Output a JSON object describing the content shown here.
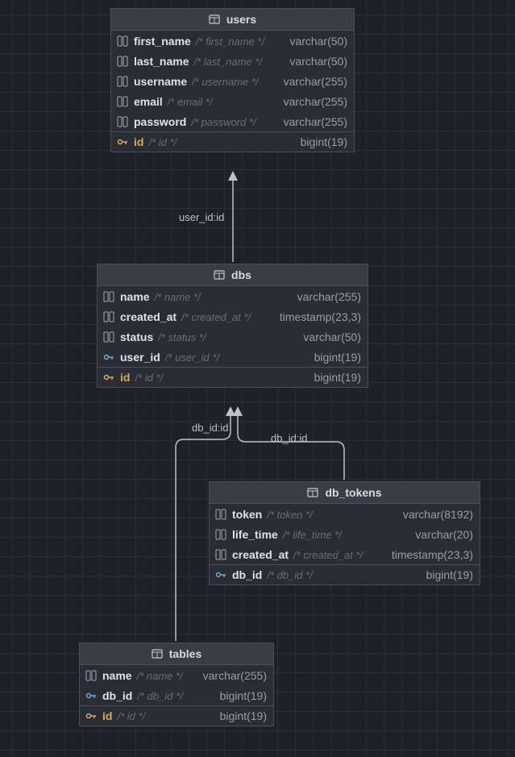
{
  "tables": {
    "users": {
      "title": "users",
      "columns": [
        {
          "name": "first_name",
          "comment": "/* first_name */",
          "type": "varchar(50)",
          "key": false,
          "fk": false
        },
        {
          "name": "last_name",
          "comment": "/* last_name */",
          "type": "varchar(50)",
          "key": false,
          "fk": false
        },
        {
          "name": "username",
          "comment": "/* username */",
          "type": "varchar(255)",
          "key": false,
          "fk": false
        },
        {
          "name": "email",
          "comment": "/* email */",
          "type": "varchar(255)",
          "key": false,
          "fk": false
        },
        {
          "name": "password",
          "comment": "/* password */",
          "type": "varchar(255)",
          "key": false,
          "fk": false
        },
        {
          "name": "id",
          "comment": "/* id */",
          "type": "bigint(19)",
          "key": true,
          "fk": false
        }
      ]
    },
    "dbs": {
      "title": "dbs",
      "columns": [
        {
          "name": "name",
          "comment": "/* name */",
          "type": "varchar(255)",
          "key": false,
          "fk": false
        },
        {
          "name": "created_at",
          "comment": "/* created_at */",
          "type": "timestamp(23,3)",
          "key": false,
          "fk": false
        },
        {
          "name": "status",
          "comment": "/* status */",
          "type": "varchar(50)",
          "key": false,
          "fk": false
        },
        {
          "name": "user_id",
          "comment": "/* user_id */",
          "type": "bigint(19)",
          "key": false,
          "fk": true
        },
        {
          "name": "id",
          "comment": "/* id */",
          "type": "bigint(19)",
          "key": true,
          "fk": false
        }
      ]
    },
    "db_tokens": {
      "title": "db_tokens",
      "columns": [
        {
          "name": "token",
          "comment": "/* token */",
          "type": "varchar(8192)",
          "key": false,
          "fk": false
        },
        {
          "name": "life_time",
          "comment": "/* life_time */",
          "type": "varchar(20)",
          "key": false,
          "fk": false
        },
        {
          "name": "created_at",
          "comment": "/* created_at */",
          "type": "timestamp(23,3)",
          "key": false,
          "fk": false
        },
        {
          "name": "db_id",
          "comment": "/* db_id */",
          "type": "bigint(19)",
          "key": false,
          "fk": true
        }
      ]
    },
    "tables_tbl": {
      "title": "tables",
      "columns": [
        {
          "name": "name",
          "comment": "/* name */",
          "type": "varchar(255)",
          "key": false,
          "fk": false
        },
        {
          "name": "db_id",
          "comment": "/* db_id */",
          "type": "bigint(19)",
          "key": false,
          "fk": true
        },
        {
          "name": "id",
          "comment": "/* id */",
          "type": "bigint(19)",
          "key": true,
          "fk": false
        }
      ]
    }
  },
  "connections": {
    "users_dbs": "user_id:id",
    "dbs_tables": "db_id:id",
    "dbs_tokens": "db_id:id"
  }
}
